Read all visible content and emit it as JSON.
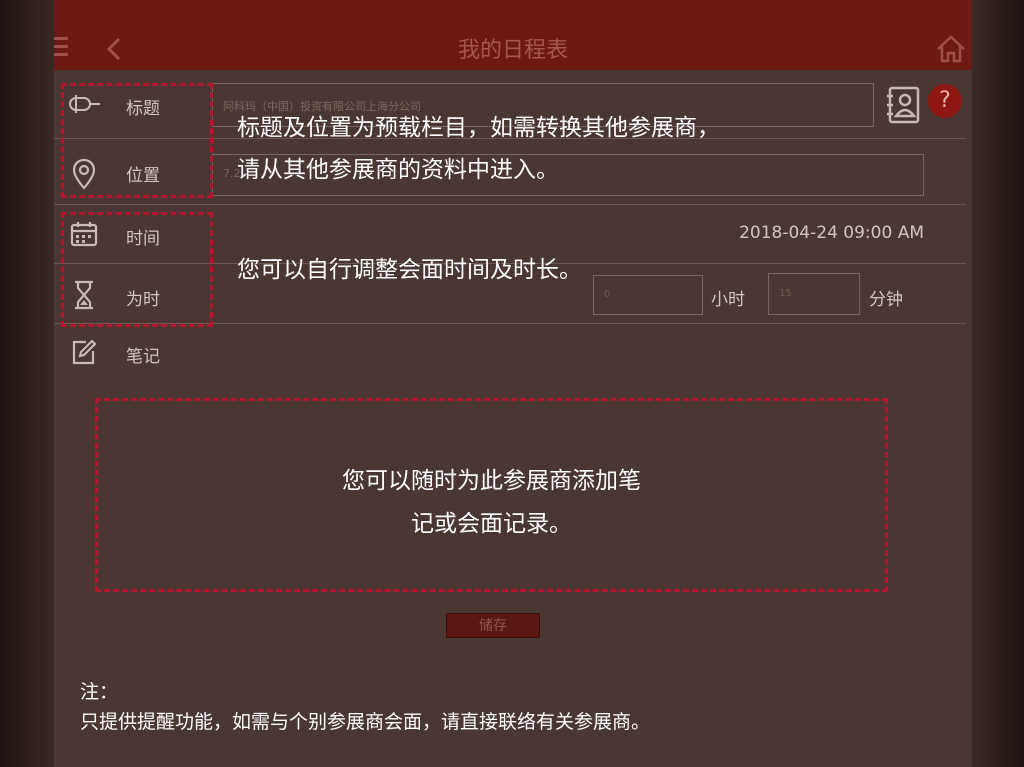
{
  "header": {
    "title": "我的日程表"
  },
  "fields": {
    "title_label": "标题",
    "title_value": "阿科玛（中国）投资有限公司上海分公司",
    "location_label": "位置",
    "location_value": "7.2",
    "time_label": "时间",
    "time_value": "2018-04-24 09:00 AM",
    "duration_label": "为时",
    "hours_value": "0",
    "hours_unit": "小时",
    "minutes_value": "15",
    "minutes_unit": "分钟",
    "notes_label": "笔记"
  },
  "help_symbol": "?",
  "save_label": "储存",
  "callouts": {
    "title_location_line1": "标题及位置为预载栏目，如需转换其他参展商，",
    "title_location_line2": "请从其他参展商的资料中进入。",
    "time_duration": "您可以自行调整会面时间及时长。",
    "notes_line1": "您可以随时为此参展商添加笔",
    "notes_line2": "记或会面记录。"
  },
  "note": {
    "title": "注：",
    "text": "只提供提醒功能，如需与个别参展商会面，请直接联络有关参展商。"
  },
  "icons": {
    "menu": "hamburger-icon",
    "back": "chevron-left-icon",
    "home": "home-icon",
    "title": "tag-icon",
    "location": "map-pin-icon",
    "time": "calendar-icon",
    "duration": "hourglass-icon",
    "notes": "edit-icon",
    "contacts": "contacts-book-icon",
    "help": "help-icon"
  },
  "colors": {
    "header": "#6e1a14",
    "background": "#4a3632",
    "highlight_dash": "#b3162c",
    "help_button": "#8e1712"
  }
}
